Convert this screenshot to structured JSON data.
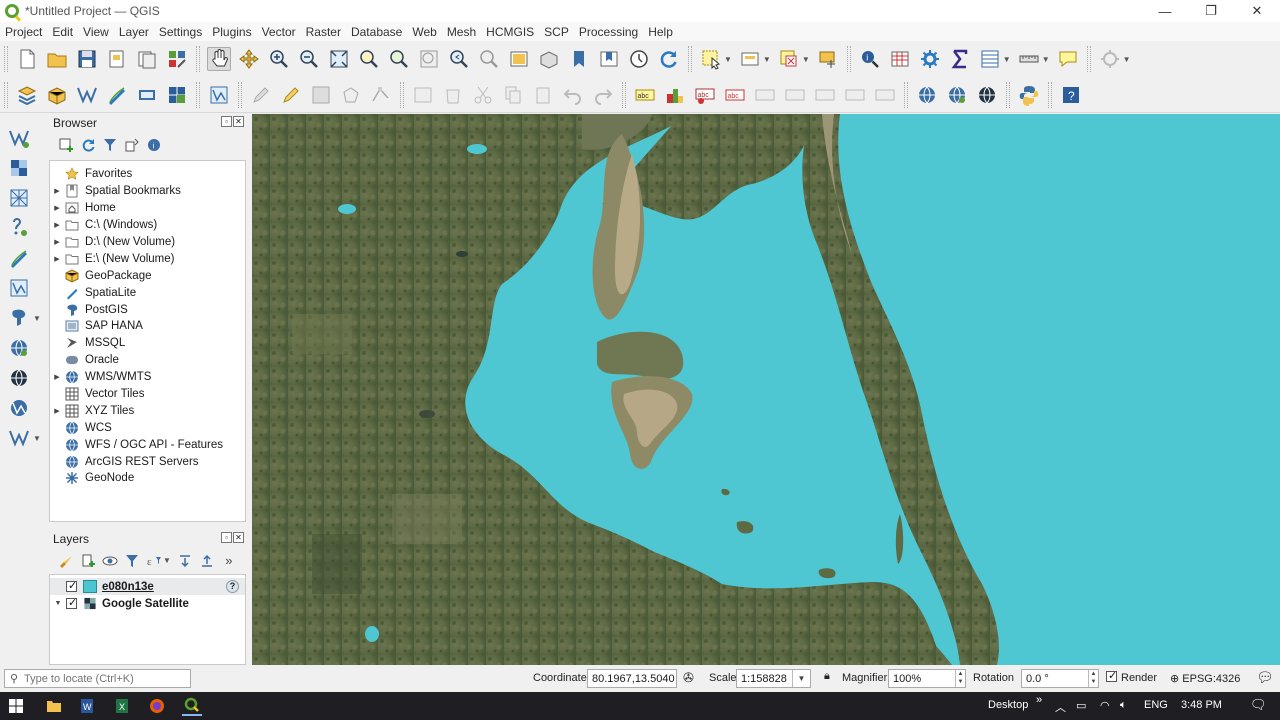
{
  "window": {
    "title": "*Untitled Project — QGIS"
  },
  "menu": [
    "Project",
    "Edit",
    "View",
    "Layer",
    "Settings",
    "Plugins",
    "Vector",
    "Raster",
    "Database",
    "Web",
    "Mesh",
    "HCMGIS",
    "SCP",
    "Processing",
    "Help"
  ],
  "browser": {
    "title": "Browser",
    "items": [
      {
        "label": "Favorites",
        "icon": "star-icon",
        "arrow": false
      },
      {
        "label": "Spatial Bookmarks",
        "icon": "bookmark-icon",
        "arrow": true
      },
      {
        "label": "Home",
        "icon": "home-folder-icon",
        "arrow": true
      },
      {
        "label": "C:\\ (Windows)",
        "icon": "folder-icon",
        "arrow": true
      },
      {
        "label": "D:\\ (New Volume)",
        "icon": "folder-icon",
        "arrow": true
      },
      {
        "label": "E:\\ (New Volume)",
        "icon": "folder-icon",
        "arrow": true
      },
      {
        "label": "GeoPackage",
        "icon": "geopackage-icon",
        "arrow": false
      },
      {
        "label": "SpatiaLite",
        "icon": "spatialite-icon",
        "arrow": false
      },
      {
        "label": "PostGIS",
        "icon": "postgis-icon",
        "arrow": false
      },
      {
        "label": "SAP HANA",
        "icon": "sap-hana-icon",
        "arrow": false
      },
      {
        "label": "MSSQL",
        "icon": "mssql-icon",
        "arrow": false
      },
      {
        "label": "Oracle",
        "icon": "oracle-icon",
        "arrow": false
      },
      {
        "label": "WMS/WMTS",
        "icon": "globe-icon",
        "arrow": true
      },
      {
        "label": "Vector Tiles",
        "icon": "grid-icon",
        "arrow": false
      },
      {
        "label": "XYZ Tiles",
        "icon": "grid-icon",
        "arrow": true
      },
      {
        "label": "WCS",
        "icon": "globe-icon",
        "arrow": false
      },
      {
        "label": "WFS / OGC API - Features",
        "icon": "globe-icon",
        "arrow": false
      },
      {
        "label": "ArcGIS REST Servers",
        "icon": "globe-icon",
        "arrow": false
      },
      {
        "label": "GeoNode",
        "icon": "geonode-icon",
        "arrow": false
      }
    ]
  },
  "layers": {
    "title": "Layers",
    "items": [
      {
        "label": "e080n13e",
        "type": "raster",
        "checked": true,
        "selected": true
      },
      {
        "label": "Google Satellite",
        "type": "xyz",
        "checked": true,
        "selected": false
      }
    ]
  },
  "statusbar": {
    "locator_placeholder": "Type to locate (Ctrl+K)",
    "coordinate_label": "Coordinate",
    "coordinate_value": "80.1967,13.5040",
    "scale_label": "Scale",
    "scale_value": "1:158828",
    "magnifier_label": "Magnifier",
    "magnifier_value": "100%",
    "rotation_label": "Rotation",
    "rotation_value": "0.0 °",
    "render_label": "Render",
    "crs": "EPSG:4326"
  },
  "taskbar": {
    "desktop": "Desktop",
    "language": "ENG",
    "time": "3:48 PM"
  },
  "colors": {
    "water": "#4fc7d2",
    "land": "#5e6a45",
    "selected_row": "#e8eaec"
  }
}
